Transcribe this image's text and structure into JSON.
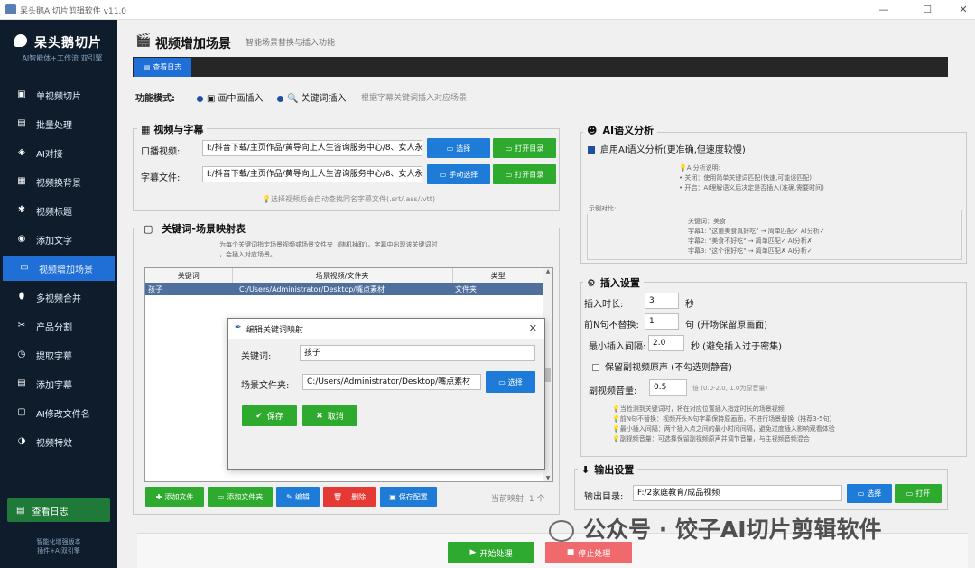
{
  "window": {
    "title": "呆头鹅AI切片剪辑软件 v11.0",
    "minimize": "—",
    "maximize": "☐",
    "close": "✕"
  },
  "sidebar": {
    "app_name": "呆头鹅切片",
    "slogan": "AI智能体+工作流 双引擎",
    "items": [
      {
        "label": "单视频切片",
        "icon": "▣"
      },
      {
        "label": "批量处理",
        "icon": "▤"
      },
      {
        "label": "AI对接",
        "icon": "◈"
      },
      {
        "label": "视频换背景",
        "icon": "▦"
      },
      {
        "label": "视频标题",
        "icon": "✱"
      },
      {
        "label": "添加文字",
        "icon": "◉"
      },
      {
        "label": "视频增加场景",
        "icon": "▭"
      },
      {
        "label": "多视频合并",
        "icon": "⬮"
      },
      {
        "label": "产品分割",
        "icon": "✂"
      },
      {
        "label": "提取字幕",
        "icon": "◷"
      },
      {
        "label": "添加字幕",
        "icon": "▤"
      },
      {
        "label": "AI修改文件名",
        "icon": "▢"
      },
      {
        "label": "视频特效",
        "icon": "◑"
      }
    ],
    "log_button": "查看日志",
    "footer_line1": "智能化增强版本",
    "footer_line2": "插件+AI双引擎"
  },
  "header": {
    "title": "视频增加场景",
    "subtitle": "智能场景替换与插入功能",
    "icon": "🎬"
  },
  "tabbar": {
    "log_tab": "查看日志"
  },
  "mode": {
    "label": "功能模式:",
    "option1": "画中画插入",
    "option2": "关键词插入",
    "hint": "根据字幕关键词插入对应场景"
  },
  "video_sub": {
    "title": "视频与字幕",
    "video_label": "口播视频:",
    "video_path": "I:/抖音下载/主页作品/黄导向上人生咨询服务中心/8、女人永远…",
    "sub_label": "字幕文件:",
    "sub_path": "I:/抖音下载/主页作品/黄导向上人生咨询服务中心/8、女人永远…",
    "select": "选择",
    "open_dir": "打开目录",
    "manual_select": "手动选择",
    "hint": "选择视频后会自动查找同名字幕文件(.srt/.ass/.vtt)"
  },
  "keyword_map": {
    "title": "关键词-场景映射表",
    "desc1": "为每个关键词指定场景视频或场景文件夹（随机抽取）。字幕中出现该关键词时",
    "desc2": "，会插入对应场景。",
    "columns": [
      "关键词",
      "场景视频/文件夹",
      "类型"
    ],
    "rows": [
      {
        "keyword": "孩子",
        "path": "C:/Users/Administrator/Desktop/嘴点素材",
        "type": "文件夹"
      }
    ],
    "buttons": {
      "add_file": "添加文件",
      "add_folder": "添加文件夹",
      "edit": "编辑",
      "delete": "删除",
      "save": "保存配置"
    },
    "count": "当前映射: 1 个"
  },
  "dialog": {
    "title": "编辑关键词映射",
    "keyword_label": "关键词:",
    "keyword_value": "孩子",
    "folder_label": "场景文件夹:",
    "folder_value": "C:/Users/Administrator/Desktop/嘴点素材",
    "select": "选择",
    "save": "保存",
    "cancel": "取消"
  },
  "ai": {
    "title": "AI语义分析",
    "checkbox": "启用AI语义分析(更准确,但速度较慢)",
    "desc_title": "AI分析说明:",
    "desc1": "• 关闭：使用简单关键词匹配(快速,可能误匹配)",
    "desc2": "• 开启：AI理解语义后决定是否插入(准确,需要时间)",
    "example_label": "示例对比:",
    "ex_kw": "关键词：美食",
    "ex1": "字幕1: \"这道美食真好吃\"  → 简单匹配✓ AI分析✓",
    "ex2": "字幕2: \"美食不好吃\"    → 简单匹配✓ AI分析✗",
    "ex3": "字幕3: \"这个很好吃\"    → 简单匹配✗ AI分析✓"
  },
  "insert": {
    "title": "插入设置",
    "duration_label": "插入时长:",
    "duration": "3",
    "duration_unit": "秒",
    "skip_label": "前N句不替换:",
    "skip": "1",
    "skip_unit": "句 (开场保留原画面)",
    "interval_label": "最小插入间隔:",
    "interval": "2.0",
    "interval_unit": "秒 (避免插入过于密集)",
    "keep_audio": "保留副视频原声 (不勾选则静音)",
    "volume_label": "副视频音量:",
    "volume": "0.5",
    "volume_hint": "倍 (0.0-2.0, 1.0为原音量)",
    "tips": [
      "当检测到关键词时，将在对应位置插入指定时长的场景视频",
      "前N句不替换：视频开头N句字幕保持原画面，不进行场景替换（推荐3-5句）",
      "最小插入间隔：两个插入点之间的最小时间间隔，避免过度插入影响观看体验",
      "副视频音量：可选择保留副视频原声并调节音量，与主视频音频混合"
    ]
  },
  "output": {
    "title": "输出设置",
    "label": "输出目录:",
    "path": "F:/2家庭教育/成品视频",
    "select": "选择",
    "open": "打开"
  },
  "actions": {
    "start": "开始处理",
    "stop": "停止处理"
  },
  "watermark": "公众号 · 饺子AI切片剪辑软件"
}
